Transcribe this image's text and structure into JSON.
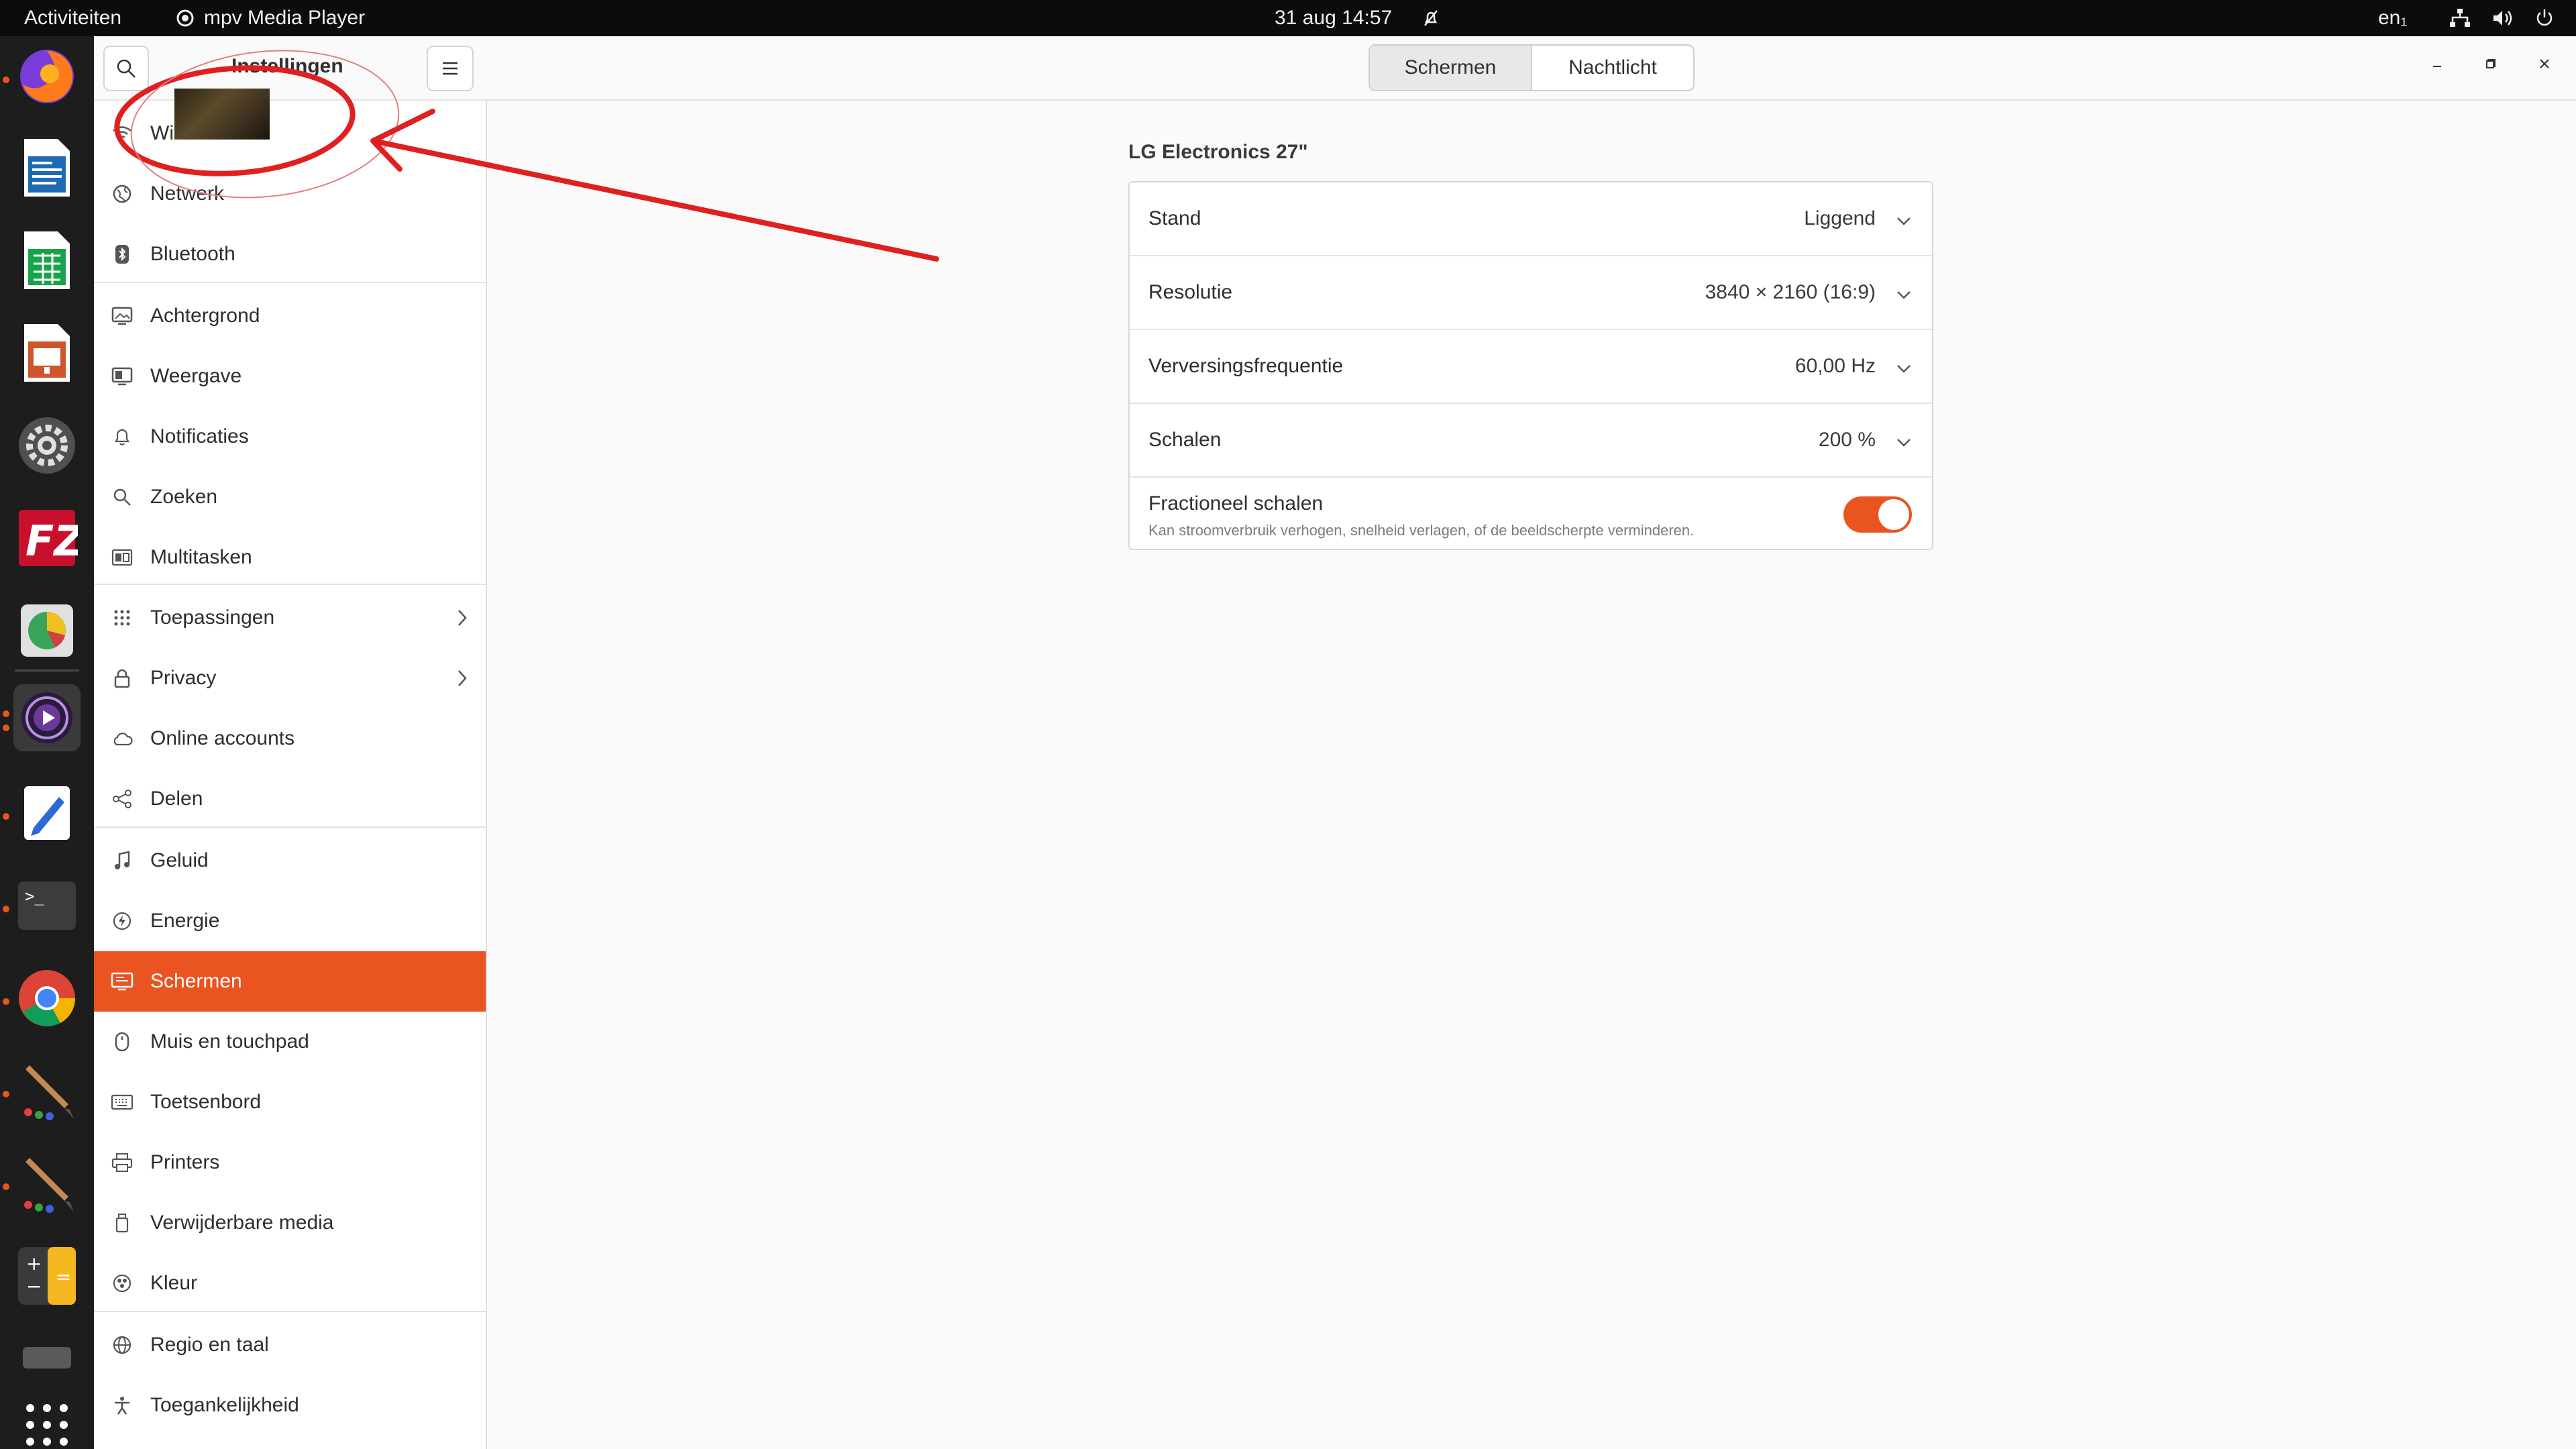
{
  "topbar": {
    "activities": "Activiteiten",
    "app_name": "mpv Media Player",
    "clock": "31 aug  14:57",
    "lang": "en₁"
  },
  "sidebar": {
    "title": "Instellingen",
    "items": [
      {
        "label": "Wi",
        "icon": "wifi-icon"
      },
      {
        "label": "Netwerk",
        "icon": "network-icon"
      },
      {
        "label": "Bluetooth",
        "icon": "bluetooth-icon"
      },
      {
        "label": "Achtergrond",
        "icon": "background-icon"
      },
      {
        "label": "Weergave",
        "icon": "appearance-icon"
      },
      {
        "label": "Notificaties",
        "icon": "bell-icon"
      },
      {
        "label": "Zoeken",
        "icon": "search-icon"
      },
      {
        "label": "Multitasken",
        "icon": "multitask-icon"
      },
      {
        "label": "Toepassingen",
        "icon": "apps-grid-icon"
      },
      {
        "label": "Privacy",
        "icon": "lock-icon"
      },
      {
        "label": "Online accounts",
        "icon": "cloud-icon"
      },
      {
        "label": "Delen",
        "icon": "share-icon"
      },
      {
        "label": "Geluid",
        "icon": "music-note-icon"
      },
      {
        "label": "Energie",
        "icon": "power-icon"
      },
      {
        "label": "Schermen",
        "icon": "display-icon"
      },
      {
        "label": "Muis en touchpad",
        "icon": "mouse-icon"
      },
      {
        "label": "Toetsenbord",
        "icon": "keyboard-icon"
      },
      {
        "label": "Printers",
        "icon": "printer-icon"
      },
      {
        "label": "Verwijderbare media",
        "icon": "removable-media-icon"
      },
      {
        "label": "Kleur",
        "icon": "color-icon"
      },
      {
        "label": "Regio en taal",
        "icon": "globe-icon"
      },
      {
        "label": "Toegankelijkheid",
        "icon": "accessibility-icon"
      }
    ]
  },
  "header": {
    "tabs": [
      "Schermen",
      "Nachtlicht"
    ]
  },
  "display": {
    "monitor_name": "LG Electronics 27\"",
    "rows": [
      {
        "label": "Stand",
        "value": "Liggend"
      },
      {
        "label": "Resolutie",
        "value": "3840 × 2160 (16:9)"
      },
      {
        "label": "Verversingsfrequentie",
        "value": "60,00 Hz"
      },
      {
        "label": "Schalen",
        "value": "200 %"
      }
    ],
    "fractional": {
      "label": "Fractioneel schalen",
      "description": "Kan stroomverbruik verhogen, snelheid verlagen, of de beeldscherpte verminderen.",
      "enabled": true
    }
  },
  "colors": {
    "accent": "#e95420",
    "annotation": "#e02020"
  }
}
